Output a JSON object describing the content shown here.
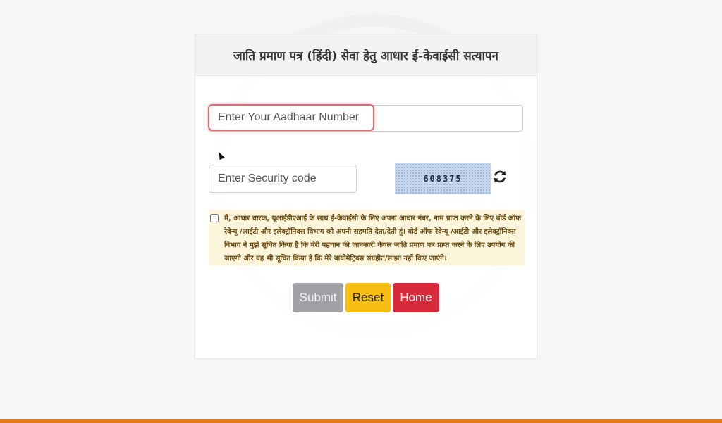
{
  "form": {
    "title": "जाति प्रमाण पत्र (हिंदी) सेवा हेतु आधार ई-केवाईसी सत्यापन",
    "aadhaar_placeholder": "Enter Your Aadhaar Number",
    "aadhaar_value": "",
    "security_placeholder": "Enter Security code",
    "security_value": "",
    "captcha_code": "608375",
    "refresh_icon": "refresh-icon",
    "consent_checked": false,
    "consent_text": "मैं, आधार धारक, यूआईडीएआई के साथ ई-केवाईसी के लिए अपना आधार नंबर, नाम प्राप्त करने के लिए बोर्ड ऑफ रेवेन्यू /आईटी और इलेक्ट्रॉनिक्स विभाग को अपनी सहमति देता/देती हूं। बोर्ड ऑफ रेवेन्यू /आईटी और इलेक्ट्रॉनिक्स विभाग ने मुझे सूचित किया है कि मेरी पहचान की जानकारी केवल जाति प्रमाण पत्र प्राप्त करने के लिए उपयोग की जाएगी और यह भी सूचित किया है कि मेरे बायोमेट्रिक्स संग्रहीत/साझा नहीं किए जाएंगे।",
    "buttons": {
      "submit_label": "Submit",
      "reset_label": "Reset",
      "home_label": "Home"
    }
  },
  "colors": {
    "submit": "#a2a2a6",
    "reset": "#f7bd12",
    "home": "#d72a3b",
    "consent_bg": "#fdf6dc",
    "aadhaar_focus_border": "#e06b73",
    "bottom_bar": "#e07a1f"
  }
}
